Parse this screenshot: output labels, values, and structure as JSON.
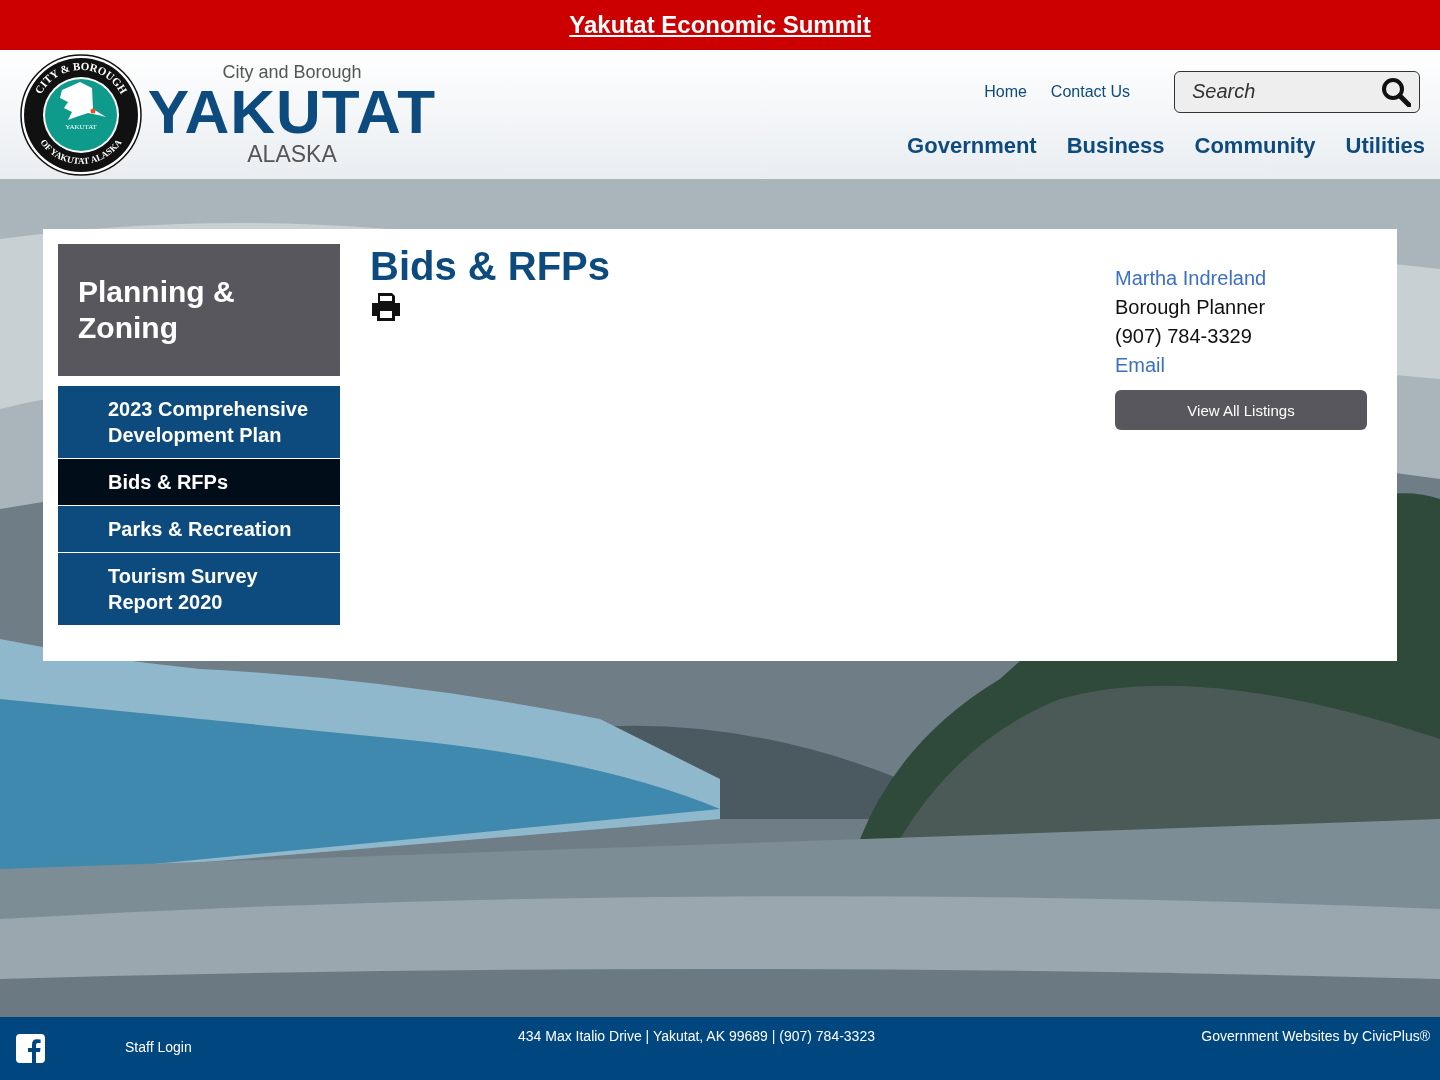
{
  "alert": {
    "text": "Yakutat Economic Summit"
  },
  "seal": {
    "top": "CITY & BOROUGH",
    "bottom": "OF YAKUTAT ALASKA",
    "inner": "YAKUTAT"
  },
  "brand": {
    "line1": "City and Borough",
    "name": "YAKUTAT",
    "line3": "ALASKA"
  },
  "utility_links": [
    "Home",
    "Contact Us"
  ],
  "search": {
    "placeholder": "Search"
  },
  "main_nav": [
    "Government",
    "Business",
    "Community",
    "Utilities"
  ],
  "sidebar": {
    "title": "Planning & Zoning",
    "items": [
      {
        "label": "2023 Comprehensive Development Plan",
        "selected": false
      },
      {
        "label": "Bids & RFPs",
        "selected": true
      },
      {
        "label": "Parks & Recreation",
        "selected": false
      },
      {
        "label": "Tourism Survey Report 2020",
        "selected": false
      }
    ]
  },
  "page": {
    "title": "Bids & RFPs"
  },
  "contact": {
    "name": "Martha Indreland",
    "role": "Borough Planner",
    "phone": "(907) 784-3329",
    "email": "Email",
    "button": "View All Listings"
  },
  "footer": {
    "staff_login": "Staff Login",
    "address": "434 Max Italio Drive | Yakutat, AK 99689 | (907) 784-3323",
    "credit": "Government Websites by CivicPlus®"
  }
}
